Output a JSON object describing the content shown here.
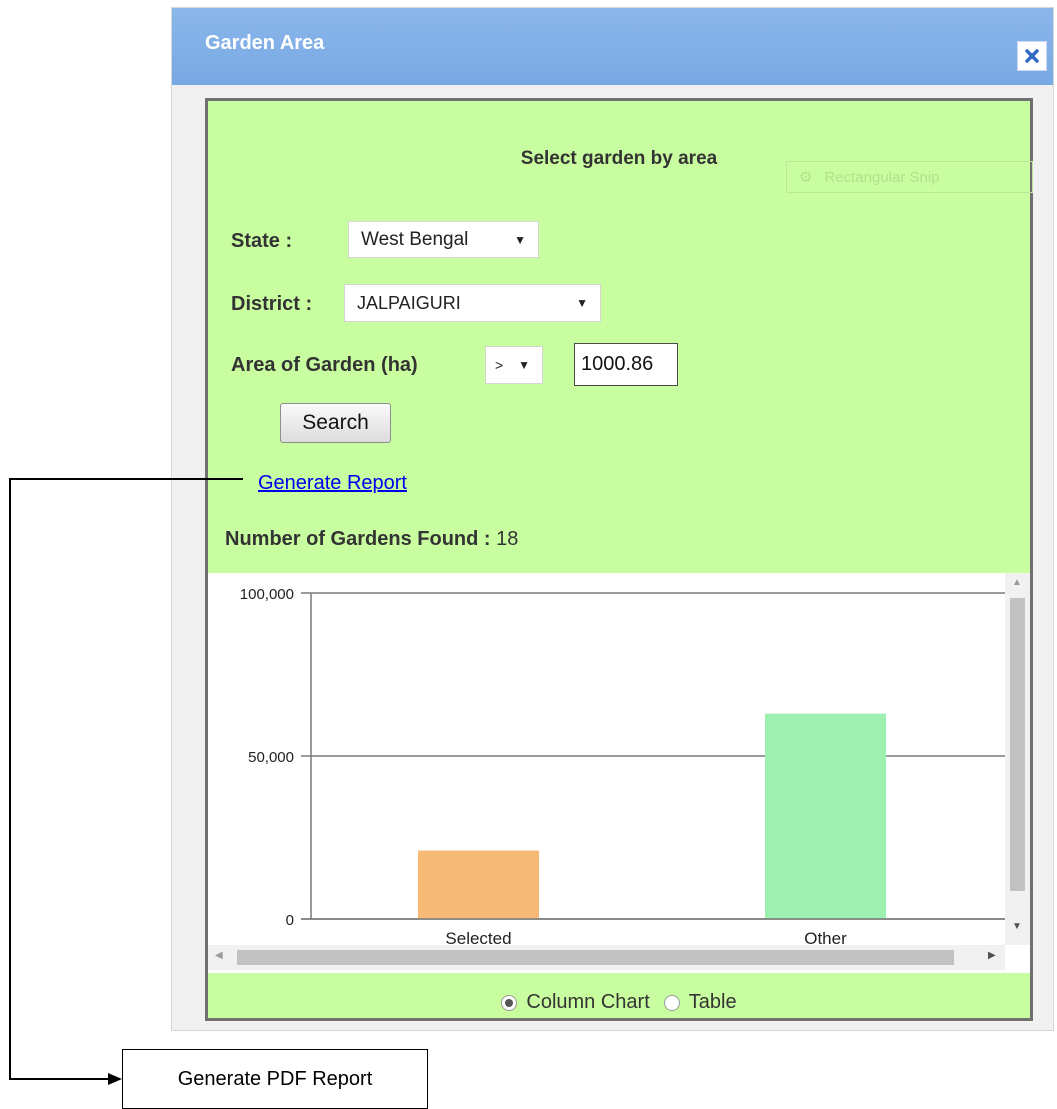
{
  "dialog": {
    "title": "Garden Area",
    "heading": "Select garden by area",
    "ghost_label": "Rectangular Snip",
    "state": {
      "label": "State :",
      "value": "West Bengal"
    },
    "district": {
      "label": "District :",
      "value": "JALPAIGURI"
    },
    "area": {
      "label": "Area of Garden (ha)",
      "operator": ">",
      "value": "1000.86"
    },
    "search_label": "Search",
    "report_link": "Generate Report",
    "found_label": "Number of Gardens Found :",
    "found_count": "18",
    "view_options": [
      {
        "label": "Column Chart",
        "selected": true
      },
      {
        "label": "Table",
        "selected": false
      }
    ]
  },
  "chart_data": {
    "type": "bar",
    "categories": [
      "Selected",
      "Other"
    ],
    "values": [
      21000,
      63000
    ],
    "yticks": [
      "0",
      "50,000",
      "100,000"
    ],
    "ylim": [
      0,
      100000
    ],
    "colors": [
      "#f7b976",
      "#9df0b0"
    ],
    "grid": true
  },
  "annotation": {
    "label": "Generate PDF Report"
  }
}
